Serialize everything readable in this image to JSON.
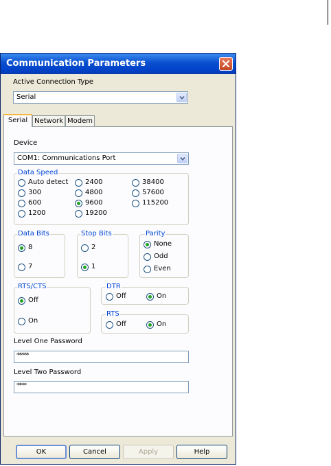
{
  "dialog": {
    "title": "Communication Parameters",
    "close_icon": "close-icon"
  },
  "connection": {
    "label": "Active Connection Type",
    "value": "Serial"
  },
  "tabs": [
    {
      "label": "Serial",
      "active": true
    },
    {
      "label": "Network",
      "active": false
    },
    {
      "label": "Modem",
      "active": false
    }
  ],
  "serial": {
    "device_label": "Device",
    "device_value": "COM1: Communications Port",
    "data_speed": {
      "legend": "Data Speed",
      "options": [
        "Auto detect",
        "300",
        "600",
        "1200",
        "2400",
        "4800",
        "9600",
        "19200",
        "38400",
        "57600",
        "115200"
      ],
      "selected": "9600"
    },
    "data_bits": {
      "legend": "Data Bits",
      "options": [
        "8",
        "7"
      ],
      "selected": "8"
    },
    "stop_bits": {
      "legend": "Stop Bits",
      "options": [
        "2",
        "1"
      ],
      "selected": "1"
    },
    "parity": {
      "legend": "Parity",
      "options": [
        "None",
        "Odd",
        "Even"
      ],
      "selected": "None"
    },
    "rts_cts": {
      "legend": "RTS/CTS",
      "options": [
        "Off",
        "On"
      ],
      "selected": "Off"
    },
    "dtr": {
      "legend": "DTR",
      "options": [
        "Off",
        "On"
      ],
      "selected": "On"
    },
    "rts": {
      "legend": "RTS",
      "options": [
        "Off",
        "On"
      ],
      "selected": "On"
    },
    "level_one": {
      "label": "Level One Password",
      "value": "*****"
    },
    "level_two": {
      "label": "Level Two Password",
      "value": "****"
    }
  },
  "buttons": {
    "ok": "OK",
    "cancel": "Cancel",
    "apply": "Apply",
    "help": "Help"
  },
  "colors": {
    "titlebar": "#0a4fcf",
    "selected_radio": "#21a121",
    "group_legend": "#0046d5",
    "active_tab_accent": "#f6b73c"
  }
}
